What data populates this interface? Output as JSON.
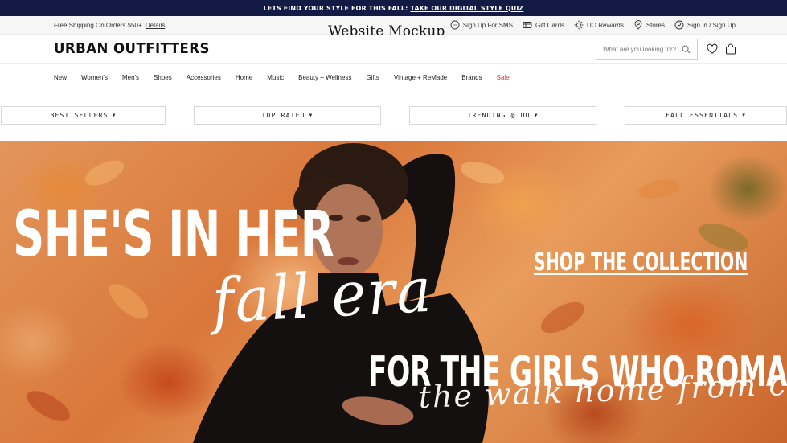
{
  "promo": {
    "text": "LETS FIND YOUR STYLE FOR THIS FALL:",
    "link": "TAKE OUR DIGITAL STYLE QUIZ"
  },
  "utility": {
    "shipping": "Free Shipping On Orders $50+",
    "details": "Details",
    "mockup_label": "Website Mockup",
    "links": [
      {
        "icon": "chat-icon",
        "label": "Sign Up For SMS"
      },
      {
        "icon": "gift-card-icon",
        "label": "Gift Cards"
      },
      {
        "icon": "rewards-icon",
        "label": "UO Rewards"
      },
      {
        "icon": "location-pin-icon",
        "label": "Stores"
      },
      {
        "icon": "user-icon",
        "label": "Sign In / Sign Up"
      }
    ]
  },
  "header": {
    "logo": "URBAN OUTFITTERS",
    "search_placeholder": "What are you looking for?"
  },
  "nav": {
    "items": [
      "New",
      "Women's",
      "Men's",
      "Shoes",
      "Accessories",
      "Home",
      "Music",
      "Beauty + Wellness",
      "Gifts",
      "Vintage + ReMade",
      "Brands",
      "Sale"
    ]
  },
  "filters": [
    "BEST SELLERS",
    "TOP RATED",
    "TRENDING @ UO",
    "FALL ESSENTIALS"
  ],
  "hero": {
    "line1": "SHE'S IN HER",
    "line2": "fall era",
    "line3": "FOR THE GIRLS WHO ROMANTICIZE",
    "line4": "the walk home from class",
    "cta": "SHOP THE COLLECTION"
  }
}
